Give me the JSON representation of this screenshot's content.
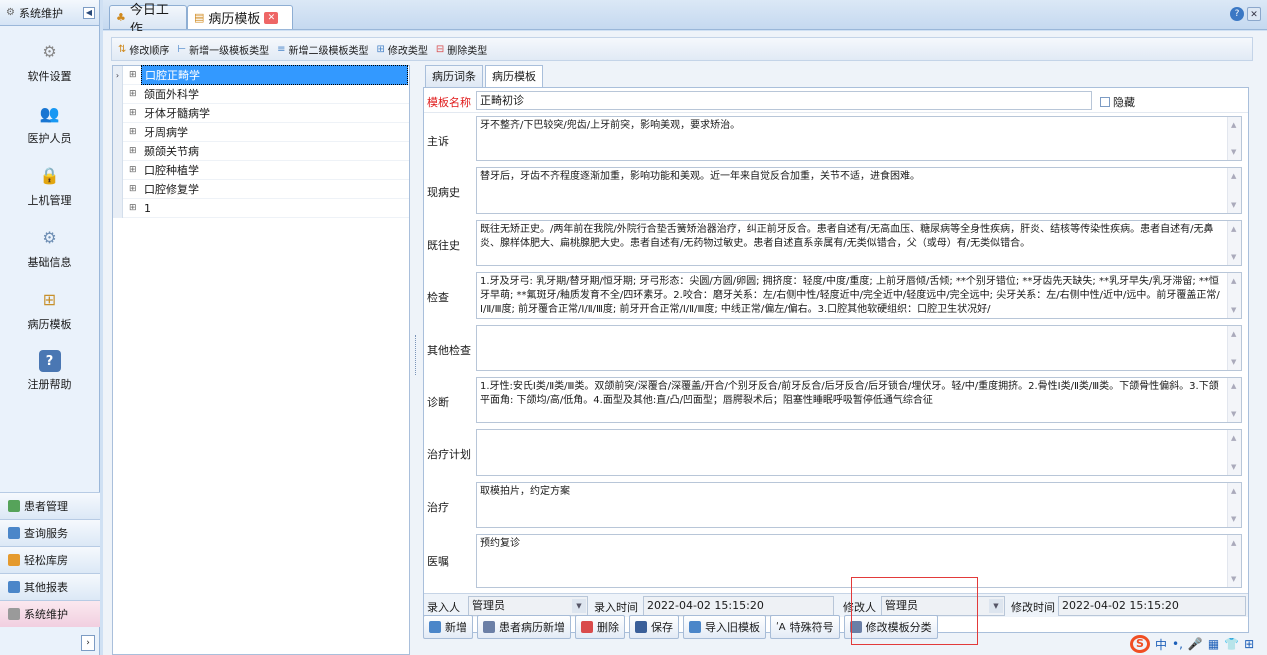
{
  "leftnav": {
    "header": "系统维护",
    "collapse_glyph": "◀",
    "items": [
      {
        "label": "软件设置",
        "icon": "gears-icon"
      },
      {
        "label": "医护人员",
        "icon": "users-icon"
      },
      {
        "label": "上机管理",
        "icon": "lock-icon"
      },
      {
        "label": "基础信息",
        "icon": "settings-gears-icon"
      },
      {
        "label": "病历模板",
        "icon": "tree-structure-icon"
      },
      {
        "label": "注册帮助",
        "icon": "help-icon"
      }
    ],
    "bottom": [
      {
        "label": "患者管理",
        "color": "#56a35a"
      },
      {
        "label": "查询服务",
        "color": "#4b86c9"
      },
      {
        "label": "轻松库房",
        "color": "#e59a2e"
      },
      {
        "label": "其他报表",
        "color": "#4b86c9"
      },
      {
        "label": "系统维护",
        "color": "#7e7e7e"
      }
    ],
    "arrow": "›"
  },
  "tabs": {
    "tab1": "今日工作",
    "tab2": "病历模板",
    "close": "✕",
    "help": "?",
    "winclose": "✕"
  },
  "toolbar": {
    "order": "修改顺序",
    "add_l1": "新增一级模板类型",
    "add_l2": "新增二级模板类型",
    "edit_type": "修改类型",
    "del_type": "删除类型"
  },
  "tree": {
    "items": [
      "口腔正畸学",
      "颌面外科学",
      "牙体牙髓病学",
      "牙周病学",
      "颞颌关节病",
      "口腔种植学",
      "口腔修复学",
      "1"
    ],
    "expand_glyph": "⊞",
    "current_glyph": "›"
  },
  "subtabs": [
    "病历词条",
    "病历模板"
  ],
  "form": {
    "name_label": "模板名称",
    "name_value": "正畸初诊",
    "hide_label": "隐藏",
    "fields": [
      {
        "label": "主诉",
        "value": "牙不整齐/下巴较突/兜齿/上牙前突，影响美观，要求矫治。"
      },
      {
        "label": "现病史",
        "value": "替牙后，牙齿不齐程度逐渐加重，影响功能和美观。近一年来自觉反合加重，关节不适，进食困难。"
      },
      {
        "label": "既往史",
        "value": "既往无矫正史。/两年前在我院/外院行合垫舌簧矫治器治疗，纠正前牙反合。患者自述有/无高血压、糖尿病等全身性疾病，肝炎、结核等传染性疾病。患者自述有/无鼻炎、腺样体肥大、扁桃腺肥大史。患者自述有/无药物过敏史。患者自述直系亲属有/无类似错合，父（或母）有/无类似错合。"
      },
      {
        "label": "检查",
        "value": "1.牙及牙弓: 乳牙期/替牙期/恒牙期; 牙弓形态：尖圆/方圆/卵圆; 拥挤度：轻度/中度/重度; 上前牙唇倾/舌倾; **个别牙错位; **牙齿先天缺失; **乳牙早失/乳牙滞留; **恒牙早萌; **氟斑牙/釉质发育不全/四环素牙。2.咬合：磨牙关系：左/右侧中性/轻度近中/完全近中/轻度远中/完全远中; 尖牙关系：左/右侧中性/近中/远中。前牙覆盖正常/Ⅰ/Ⅱ/Ⅲ度; 前牙覆合正常/Ⅰ/Ⅱ/Ⅲ度; 前牙开合正常/Ⅰ/Ⅱ/Ⅲ度; 中线正常/偏左/偏右。3.口腔其他软硬组织：口腔卫生状况好/"
      },
      {
        "label": "其他检查",
        "value": ""
      },
      {
        "label": "诊断",
        "value": "1.牙性:安氏Ⅰ类/Ⅱ类/Ⅲ类。双颌前突/深覆合/深覆盖/开合/个别牙反合/前牙反合/后牙反合/后牙锁合/埋伏牙。轻/中/重度拥挤。2.骨性Ⅰ类/Ⅱ类/Ⅲ类。下颌骨性偏斜。3.下颌平面角: 下颌均/高/低角。4.面型及其他:直/凸/凹面型；唇腭裂术后；阻塞性睡眠呼吸暂停低通气综合征"
      },
      {
        "label": "治疗计划",
        "value": ""
      },
      {
        "label": "治疗",
        "value": "取模拍片，约定方案"
      },
      {
        "label": "医嘱",
        "value": "预约复诊"
      }
    ],
    "entry_label": "录入人",
    "entry_value": "管理员",
    "entry_time_label": "录入时间",
    "entry_time_value": "2022-04-02 15:15:20",
    "mod_label": "修改人",
    "mod_value": "管理员",
    "mod_time_label": "修改时间",
    "mod_time_value": "2022-04-02 15:15:20"
  },
  "buttons": [
    {
      "label": "新增",
      "name": "add-button",
      "color": "#4b86c9"
    },
    {
      "label": "患者病历新增",
      "name": "patient-record-add-button",
      "color": "#6b7fa6"
    },
    {
      "label": "删除",
      "name": "delete-button",
      "color": "#d94b4b"
    },
    {
      "label": "保存",
      "name": "save-button",
      "color": "#3a5f99"
    },
    {
      "label": "导入旧模板",
      "name": "import-old-template-button",
      "color": "#4b86c9"
    },
    {
      "label": "特殊符号",
      "name": "special-symbols-button",
      "color": "#333"
    },
    {
      "label": "修改模板分类",
      "name": "edit-template-category-button",
      "color": "#6b7fa6"
    }
  ],
  "tray": {
    "ime": "S",
    "lang": "中",
    "punct": "•,",
    "mic": "🎤",
    "kbd": "▦",
    "skin": "👕",
    "grid": "⊞"
  }
}
